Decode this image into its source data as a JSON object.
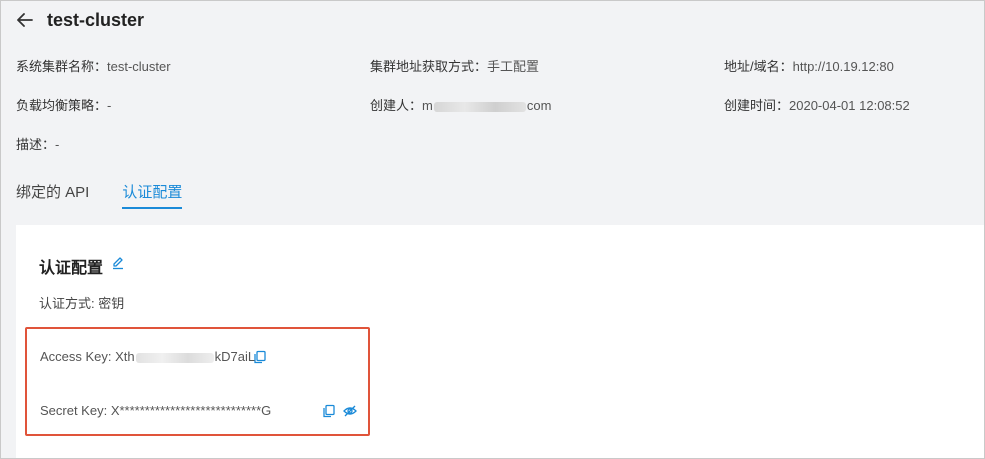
{
  "page": {
    "title": "test-cluster"
  },
  "info": {
    "cluster_name_label": "系统集群名称：",
    "cluster_name_value": "test-cluster",
    "addr_method_label": "集群地址获取方式：",
    "addr_method_value": "手工配置",
    "address_label": "地址/域名：",
    "address_value": "http://10.19.12:80",
    "lb_label": "负载均衡策略：",
    "lb_value": "-",
    "creator_label": "创建人：",
    "creator_prefix": "m",
    "creator_suffix": "com",
    "created_label": "创建时间：",
    "created_value": "2020-04-01 12:08:52",
    "desc_label": "描述：",
    "desc_value": "-"
  },
  "tabs": [
    {
      "label": "绑定的 API",
      "active": false
    },
    {
      "label": "认证配置",
      "active": true
    }
  ],
  "auth": {
    "section_title": "认证配置",
    "method_label": "认证方式: ",
    "method_value": "密钥",
    "access_key_label": "Access Key: ",
    "access_key_prefix": "Xth",
    "access_key_suffix": "kD7aiL",
    "secret_key_label": "Secret Key: ",
    "secret_key_value": "X****************************G"
  },
  "icons": {
    "back": "arrow-left-icon",
    "edit": "pencil-icon",
    "copy": "copy-icon",
    "visibility": "eye-off-icon"
  },
  "colors": {
    "accent": "#1a8ad8",
    "highlight_border": "#e0543a",
    "header_bg": "#f2f3f5"
  }
}
